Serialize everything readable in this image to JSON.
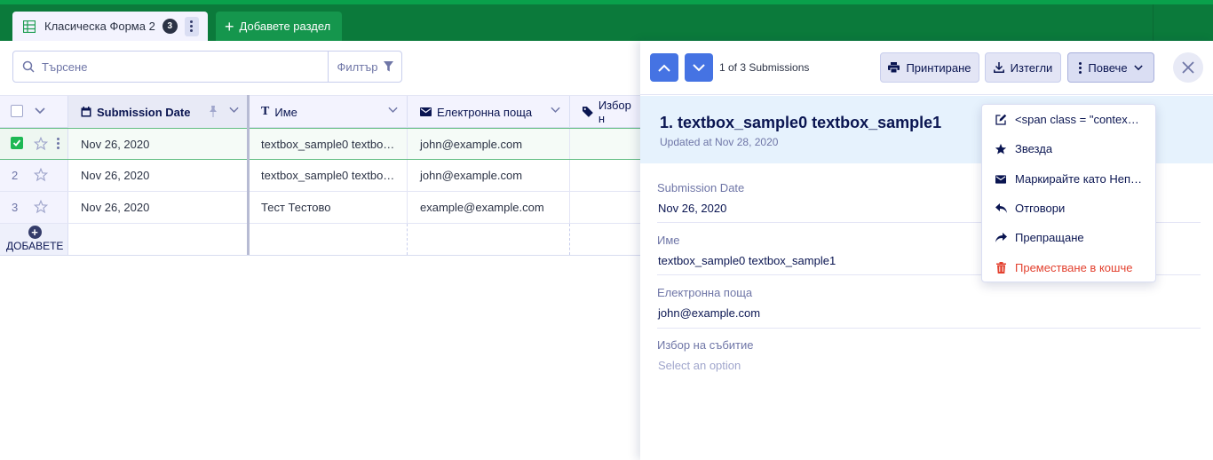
{
  "tabs": {
    "active_label": "Класическа Форма 2",
    "active_badge": "3",
    "add_section_label": "Добавете раздел"
  },
  "toolbar": {
    "search_placeholder": "Търсене",
    "filter_label": "Филтър"
  },
  "table": {
    "columns": [
      {
        "label": "Submission Date",
        "icon": "calendar-icon"
      },
      {
        "label": "Име",
        "icon": "text-icon"
      },
      {
        "label": "Електронна поща",
        "icon": "mail-icon"
      },
      {
        "label": "Избор н",
        "icon": "tag-icon"
      }
    ],
    "rows": [
      {
        "num": "",
        "date": "Nov 26, 2020",
        "name": "textbox_sample0 textbo…",
        "email": "john@example.com",
        "selected": true
      },
      {
        "num": "2",
        "date": "Nov 26, 2020",
        "name": "textbox_sample0 textbo…",
        "email": "john@example.com",
        "selected": false
      },
      {
        "num": "3",
        "date": "Nov 26, 2020",
        "name": "Тест Тестово",
        "email": "example@example.com",
        "selected": false
      }
    ],
    "add_label": "ДОБАВЕТЕ"
  },
  "panel": {
    "count_text": "1 of 3 Submissions",
    "print_label": "Принтиране",
    "download_label": "Изтегли",
    "more_label": "Повече",
    "title": "1. textbox_sample0 textbox_sample1",
    "updated": "Updated at Nov 28, 2020",
    "fields": [
      {
        "label": "Submission Date",
        "value": "Nov 26, 2020"
      },
      {
        "label": "Име",
        "value": "textbox_sample0 textbox_sample1"
      },
      {
        "label": "Електронна поща",
        "value": "john@example.com"
      },
      {
        "label": "Избор на събитие",
        "value": "Select an option"
      }
    ]
  },
  "menu": {
    "items": [
      {
        "label": "<span class = \"contex…",
        "icon": "edit-icon"
      },
      {
        "label": "Звезда",
        "icon": "star-icon"
      },
      {
        "label": "Маркирайте като Неп…",
        "icon": "mail-icon"
      },
      {
        "label": "Отговори",
        "icon": "reply-icon"
      },
      {
        "label": "Препращане",
        "icon": "forward-icon"
      },
      {
        "label": "Преместване в кошче",
        "icon": "trash-icon"
      }
    ]
  },
  "colors": {
    "topbar": "#0b7a3b",
    "accent_blue": "#4573e3",
    "selected_check": "#1db854",
    "danger": "#e3412f"
  }
}
